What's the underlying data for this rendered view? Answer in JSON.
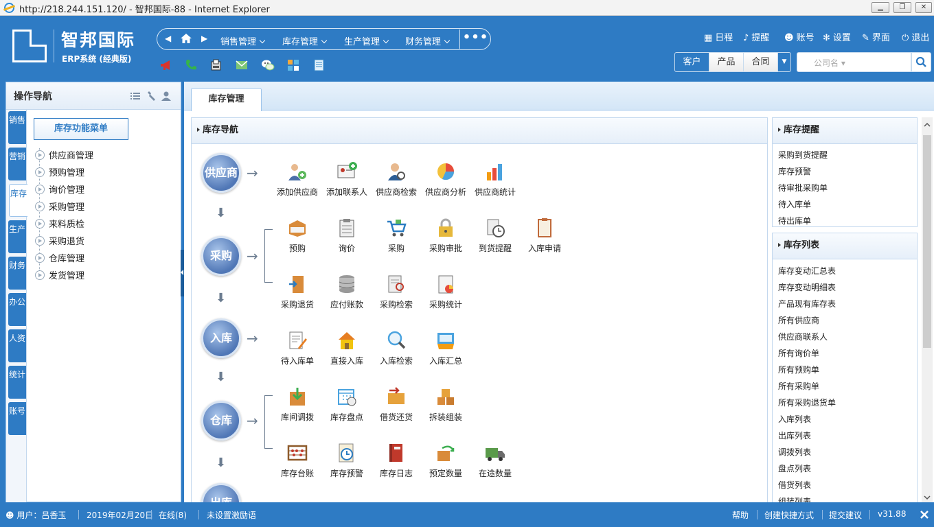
{
  "window": {
    "title": "http://218.244.151.120/ - 智邦国际-88 - Internet Explorer",
    "min_label": "▁",
    "restore_label": "❐",
    "close_label": "✕"
  },
  "brand": {
    "name": "智邦国际",
    "subtitle": "ERP系统 (经典版)"
  },
  "nav": {
    "prev": "◀",
    "next": "▶",
    "more": "•••",
    "menus": [
      "销售管理",
      "库存管理",
      "生产管理",
      "财务管理"
    ]
  },
  "quick_icons": [
    "megaphone-icon",
    "phone-icon",
    "fax-icon",
    "mail-icon",
    "wechat-icon",
    "grid-icon",
    "document-icon"
  ],
  "top_links": [
    "日程",
    "提醒",
    "账号",
    "设置",
    "界面",
    "退出"
  ],
  "search": {
    "segments": [
      "客户",
      "产品",
      "合同"
    ],
    "active_segment": "客户",
    "placeholder": "公司名 ▾"
  },
  "left": {
    "title": "操作导航",
    "vtabs": [
      {
        "label": "销售",
        "active": false
      },
      {
        "label": "营销",
        "active": false
      },
      {
        "label": "库存",
        "active": true
      },
      {
        "label": "生产",
        "active": false
      },
      {
        "label": "财务",
        "active": false
      },
      {
        "label": "办公",
        "active": false
      },
      {
        "label": "人资",
        "active": false
      },
      {
        "label": "统计",
        "active": false
      },
      {
        "label": "账号",
        "active": false
      }
    ],
    "menu_title": "库存功能菜单",
    "tree": [
      "供应商管理",
      "预购管理",
      "询价管理",
      "采购管理",
      "来料质检",
      "采购退货",
      "仓库管理",
      "发货管理"
    ]
  },
  "main": {
    "tab": "库存管理",
    "nav_title": "库存导航",
    "stages": [
      "供应商",
      "采购",
      "入库",
      "仓库",
      "出库"
    ],
    "supplier_items": [
      "添加供应商",
      "添加联系人",
      "供应商检索",
      "供应商分析",
      "供应商统计"
    ],
    "purchase_items_1": [
      "预购",
      "询价",
      "采购",
      "采购审批",
      "到货提醒",
      "入库申请"
    ],
    "purchase_items_2": [
      "采购退货",
      "应付账款",
      "采购检索",
      "采购统计"
    ],
    "inbound_items": [
      "待入库单",
      "直接入库",
      "入库检索",
      "入库汇总"
    ],
    "warehouse_items_1": [
      "库间调拨",
      "库存盘点",
      "借货还货",
      "拆装组装"
    ],
    "warehouse_items_2": [
      "库存台账",
      "库存预警",
      "库存日志",
      "预定数量",
      "在途数量"
    ],
    "remind_title": "库存提醒",
    "remind_links": [
      "采购到货提醒",
      "库存预警",
      "待审批采购单",
      "待入库单",
      "待出库单"
    ],
    "list_title": "库存列表",
    "list_links": [
      "库存变动汇总表",
      "库存变动明细表",
      "产品现有库存表",
      "所有供应商",
      "供应商联系人",
      "所有询价单",
      "所有预购单",
      "所有采购单",
      "所有采购退货单",
      "入库列表",
      "出库列表",
      "调拨列表",
      "盘点列表",
      "借货列表",
      "组装列表"
    ]
  },
  "status": {
    "user": "用户：吕香玉",
    "date": "2019年02月20日",
    "online": "在线(8)",
    "motto": "未设置激励语",
    "links": [
      "帮助",
      "创建快捷方式",
      "提交建议"
    ],
    "version": "v31.88"
  },
  "colors": {
    "primary": "#2e7bc4",
    "accent_dark": "#1c5d9b"
  }
}
